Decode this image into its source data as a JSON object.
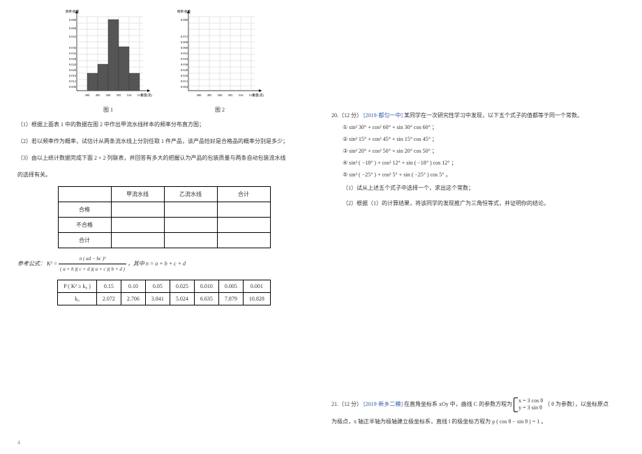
{
  "chart_data": [
    {
      "type": "bar",
      "title": "",
      "xlabel": "重量(克)",
      "ylabel": "频率/组距",
      "categories": [
        "490–495",
        "495–500",
        "500–505",
        "505–510",
        "510–515"
      ],
      "values": [
        0.02,
        0.03,
        0.08,
        0.05,
        0.02
      ],
      "x_ticks": [
        490,
        495,
        500,
        505,
        510,
        515
      ],
      "y_ticks": [
        0.006,
        0.012,
        0.016,
        0.02,
        0.024,
        0.028,
        0.032,
        0.036,
        0.052,
        0.06,
        0.08
      ],
      "ylim": [
        0,
        0.085
      ]
    },
    {
      "type": "bar",
      "title": "",
      "xlabel": "重量(克)",
      "ylabel": "频率/组距",
      "categories": [
        "490–495",
        "495–500",
        "500–505",
        "505–510",
        "510–515"
      ],
      "values": [],
      "x_ticks": [
        490,
        495,
        500,
        505,
        510,
        515
      ],
      "y_ticks": [
        0.004,
        0.012,
        0.02,
        0.028,
        0.036,
        0.044,
        0.052,
        0.06,
        0.068,
        0.072,
        0.08
      ],
      "ylim": [
        0,
        0.085
      ]
    }
  ],
  "left": {
    "fig1_label": "图 1",
    "fig2_label": "图 2",
    "q1": "（1）根据上面表 1 中的数据在图 2 中作出甲流水线样本的频率分布直方图；",
    "q2": "（2）若以频率作为概率，试估计从两条流水线上分别任取 1 件产品，该产品恰好是合格品的概率分别是多少；",
    "q3a": "（3）由以上统计数据完成下面 2 × 2 列联表，并回答有多大的把握认为产品的包装质量与两条自动包装流水线",
    "q3b": "的选择有关。",
    "ct_headers": [
      "",
      "甲流水线",
      "乙流水线",
      "合计"
    ],
    "ct_rows": [
      "合格",
      "不合格",
      "合计"
    ],
    "formula_prefix": "参考公式：",
    "formula_var": "K² = ",
    "formula_num": "n ( ad − bc )²",
    "formula_den": "( a + b )( c + d )( a + c )( b + d )",
    "formula_suffix": " ，其中 n = a + b + c + d",
    "ptable": {
      "row1_head": "P ( K² ≥ k₀ )",
      "row2_head": "k₀",
      "p_vals": [
        "0.15",
        "0.10",
        "0.05",
        "0.025",
        "0.010",
        "0.005",
        "0.001"
      ],
      "k_vals": [
        "2.072",
        "2.706",
        "3.841",
        "5.024",
        "6.635",
        "7.879",
        "10.828"
      ]
    }
  },
  "right": {
    "q20_head": "20.（12 分）",
    "q20_src": "[2019·都匀一中]",
    "q20_tail": "某同学在一次研究性学习中发现，以下五个式子的值都等于同一个常数。",
    "e1": "① sin² 30° + cos² 60° + sin 30° cos 60° ；",
    "e2": "② sin² 15° + cos² 45° + sin 15° cos 45° ；",
    "e3": "③ sin² 20° + cos² 50° + sin 20° cos 50° ；",
    "e4": "④ sin² ( −18° ) + cos² 12° + sin ( −18° ) cos 12° ；",
    "e5": "⑤ sin² ( −25° ) + cos² 5° + sin ( −25° ) cos 5° 。",
    "q20_1": "（1）试从上述五个式子中选择一个，求出这个常数；",
    "q20_2": "（2）根据（1）的计算结果，将该同学的发现推广为三角恒等式，并证明你的结论。",
    "q21_head": "21.（12 分）",
    "q21_src": "[2019·新乡二模]",
    "q21_a": "在直角坐标系 xOy 中，曲线 C 的参数方程为",
    "q21_case1": "x = 3 cos θ",
    "q21_case2": "y = 3 sin θ",
    "q21_b": "（ θ 为参数），以坐标原点",
    "q21_c": "为极点，x 轴正半轴为极轴建立极坐标系，直线 l 的极坐标方程为 ρ ( cos θ − sin θ ) = 1 。"
  },
  "foot": "4"
}
